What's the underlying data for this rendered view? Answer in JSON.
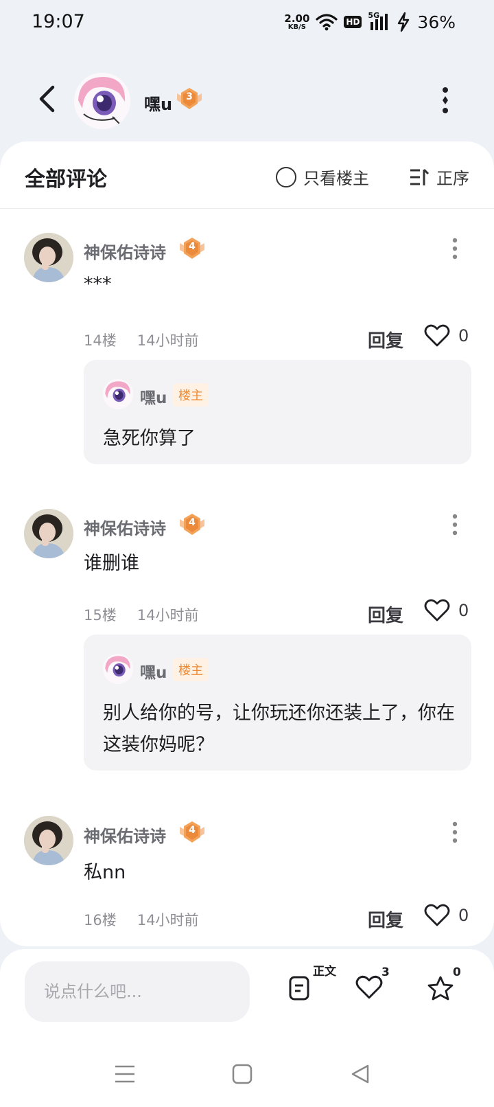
{
  "status_bar": {
    "time": "19:07",
    "net_speed_value": "2.00",
    "net_speed_unit": "KB/S",
    "hd": "HD",
    "signal": "5G",
    "battery": "36%"
  },
  "header": {
    "name": "嘿u",
    "level": "3"
  },
  "filter": {
    "title": "全部评论",
    "op_only_label": "只看楼主",
    "sort_label": "正序"
  },
  "comments": [
    {
      "author": "神保佑诗诗",
      "level": "4",
      "text": "***",
      "floor": "14楼",
      "time": "14小时前",
      "reply_label": "回复",
      "likes": "0",
      "reply": {
        "author": "嘿u",
        "tag": "楼主",
        "text": "急死你算了"
      }
    },
    {
      "author": "神保佑诗诗",
      "level": "4",
      "text": "谁删谁",
      "floor": "15楼",
      "time": "14小时前",
      "reply_label": "回复",
      "likes": "0",
      "reply": {
        "author": "嘿u",
        "tag": "楼主",
        "text": "别人给你的号，让你玩还你还装上了，你在这装你妈呢？"
      }
    },
    {
      "author": "神保佑诗诗",
      "level": "4",
      "text": "私nn",
      "floor": "16楼",
      "time": "14小时前",
      "reply_label": "回复",
      "likes": "0"
    }
  ],
  "bottom_bar": {
    "input_placeholder": "说点什么吧...",
    "article_label": "正文",
    "like_count": "3",
    "star_count": "0"
  },
  "colors": {
    "level_badge": "#f3a25a",
    "op_tag_text": "#ef8b32",
    "op_tag_bg": "#fff1e3",
    "page_bg": "#eef2f6"
  }
}
